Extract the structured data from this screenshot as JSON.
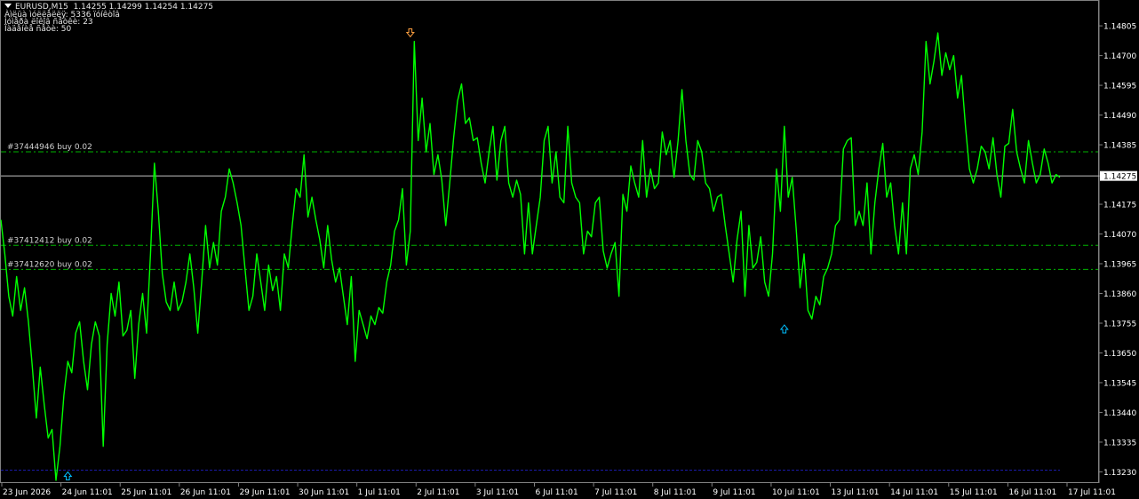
{
  "chart_header": {
    "symbol": "EURUSD,M15",
    "ohlc": "1.14255 1.14299 1.14254 1.14275",
    "info_line_1": "Àìëüà ìóëëåëëÿ: 5336 ïóíêòîâ",
    "info_line_2": "Íóìåðà ëîêîâ ñåòêè: 23",
    "info_line_3": "Ïàäåíèå ñåòè: 50"
  },
  "colors": {
    "background": "#000000",
    "price_line": "#00ff00",
    "order_line": "#00b400",
    "current_price_line": "#c0c0c0",
    "low_line": "#1a1aa8",
    "arrow_up": "#00bfff",
    "arrow_down": "#ffa040",
    "axis_text": "#ffffff"
  },
  "orders": [
    {
      "label": "#37444946 buy 0.02",
      "price": 1.1436
    },
    {
      "label": "#37412412 buy 0.02",
      "price": 1.1403
    },
    {
      "label": "#37412620 buy 0.02",
      "price": 1.13945
    }
  ],
  "chart_data": {
    "type": "line",
    "symbol": "EURUSD",
    "timeframe": "M15",
    "current_price": "1.14275",
    "y_ticks": [
      "1.14805",
      "1.14700",
      "1.14595",
      "1.14490",
      "1.14385",
      "1.14275",
      "1.14175",
      "1.14070",
      "1.13965",
      "1.13860",
      "1.13755",
      "1.13650",
      "1.13545",
      "1.13440",
      "1.13335",
      "1.13230"
    ],
    "x_ticks": [
      "23 Jun 2026",
      "24 Jun 11:01",
      "25 Jun 11:01",
      "26 Jun 11:01",
      "29 Jun 11:01",
      "30 Jun 11:01",
      "1 Jul 11:01",
      "2 Jul 11:01",
      "3 Jul 11:01",
      "6 Jul 11:01",
      "7 Jul 11:01",
      "8 Jul 11:01",
      "9 Jul 11:01",
      "10 Jul 11:01",
      "13 Jul 11:01",
      "14 Jul 11:01",
      "15 Jul 11:01",
      "16 Jul 11:01",
      "17 Jul 11:01"
    ],
    "ylim": [
      1.132,
      1.1489
    ],
    "low_level": 1.13236,
    "series": [
      {
        "values": [
          1.1412,
          1.14,
          1.1385,
          1.1378,
          1.1392,
          1.138,
          1.1388,
          1.1376,
          1.136,
          1.1342,
          1.136,
          1.1347,
          1.1335,
          1.1338,
          1.132,
          1.1332,
          1.135,
          1.1362,
          1.1358,
          1.1372,
          1.1376,
          1.1362,
          1.1352,
          1.1368,
          1.1376,
          1.1371,
          1.1332,
          1.1368,
          1.1386,
          1.1378,
          1.139,
          1.1371,
          1.1373,
          1.138,
          1.1356,
          1.1375,
          1.1386,
          1.1372,
          1.14,
          1.1432,
          1.1415,
          1.1393,
          1.1383,
          1.138,
          1.139,
          1.138,
          1.1383,
          1.139,
          1.14,
          1.1388,
          1.1372,
          1.139,
          1.141,
          1.1395,
          1.1404,
          1.1396,
          1.1415,
          1.142,
          1.143,
          1.1425,
          1.1418,
          1.141,
          1.1395,
          1.138,
          1.1385,
          1.14,
          1.139,
          1.138,
          1.1396,
          1.1387,
          1.1392,
          1.138,
          1.14,
          1.1395,
          1.141,
          1.1423,
          1.142,
          1.1435,
          1.1413,
          1.142,
          1.1412,
          1.1405,
          1.1395,
          1.141,
          1.1398,
          1.139,
          1.1395,
          1.1385,
          1.1375,
          1.1392,
          1.1362,
          1.138,
          1.1375,
          1.137,
          1.1378,
          1.1375,
          1.1381,
          1.1379,
          1.139,
          1.1396,
          1.1408,
          1.1412,
          1.1423,
          1.1396,
          1.1408,
          1.1475,
          1.144,
          1.1455,
          1.1436,
          1.1446,
          1.1428,
          1.1435,
          1.1426,
          1.141,
          1.1425,
          1.1441,
          1.1454,
          1.146,
          1.1446,
          1.1448,
          1.144,
          1.1441,
          1.1432,
          1.1425,
          1.1436,
          1.1445,
          1.1426,
          1.144,
          1.1445,
          1.1425,
          1.142,
          1.1426,
          1.1421,
          1.14,
          1.1418,
          1.14,
          1.141,
          1.142,
          1.144,
          1.1445,
          1.1425,
          1.1436,
          1.142,
          1.1418,
          1.1445,
          1.1425,
          1.142,
          1.1418,
          1.14,
          1.1408,
          1.1406,
          1.1418,
          1.142,
          1.1401,
          1.1395,
          1.14,
          1.1404,
          1.1385,
          1.1421,
          1.1415,
          1.1431,
          1.1425,
          1.142,
          1.144,
          1.142,
          1.143,
          1.1423,
          1.1425,
          1.1443,
          1.1435,
          1.144,
          1.1427,
          1.144,
          1.1458,
          1.144,
          1.1428,
          1.1426,
          1.144,
          1.1436,
          1.1425,
          1.1423,
          1.1415,
          1.142,
          1.1421,
          1.141,
          1.14,
          1.139,
          1.1405,
          1.1415,
          1.1385,
          1.141,
          1.1395,
          1.1397,
          1.1406,
          1.139,
          1.1385,
          1.14,
          1.143,
          1.1415,
          1.1445,
          1.142,
          1.1427,
          1.1409,
          1.1388,
          1.14,
          1.138,
          1.1377,
          1.1385,
          1.1382,
          1.1392,
          1.1395,
          1.14,
          1.141,
          1.1412,
          1.1437,
          1.144,
          1.1441,
          1.141,
          1.1415,
          1.141,
          1.1425,
          1.14,
          1.1418,
          1.143,
          1.1439,
          1.142,
          1.1425,
          1.141,
          1.14,
          1.1418,
          1.14,
          1.143,
          1.1435,
          1.1428,
          1.1443,
          1.1475,
          1.146,
          1.1468,
          1.1478,
          1.1463,
          1.1471,
          1.1465,
          1.147,
          1.1455,
          1.1463,
          1.1445,
          1.143,
          1.1425,
          1.143,
          1.1438,
          1.1436,
          1.143,
          1.1441,
          1.1428,
          1.142,
          1.1438,
          1.1439,
          1.1451,
          1.1436,
          1.143,
          1.1425,
          1.144,
          1.1432,
          1.1425,
          1.1428,
          1.1437,
          1.1432,
          1.1425,
          1.1428,
          1.1427
        ]
      }
    ],
    "arrows": [
      {
        "type": "buy",
        "bar": 17,
        "price": 1.13236
      },
      {
        "type": "sell",
        "bar": 104,
        "price": 1.1476
      },
      {
        "type": "buy",
        "bar": 199,
        "price": 1.13755
      }
    ]
  }
}
